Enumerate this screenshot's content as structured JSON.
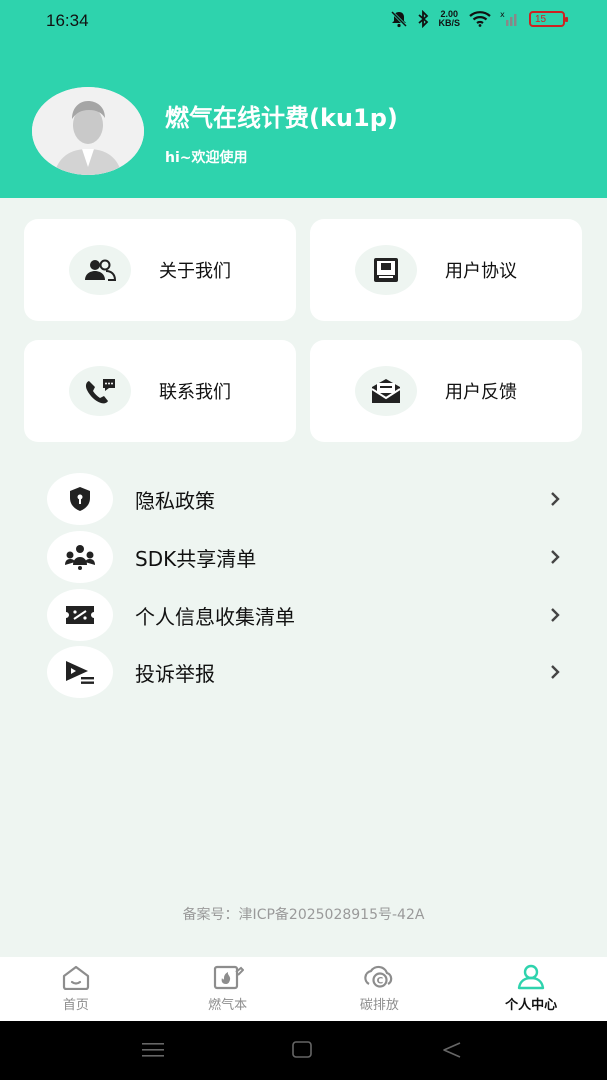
{
  "status_bar": {
    "time": "16:34",
    "net_speed_value": "2.00",
    "net_speed_unit": "KB/S",
    "battery": "15"
  },
  "profile": {
    "title": "燃气在线计费(ku1p)",
    "subtitle": "hi~欢迎使用"
  },
  "cards": [
    {
      "label": "关于我们",
      "icon": "people-icon"
    },
    {
      "label": "用户协议",
      "icon": "document-icon"
    },
    {
      "label": "联系我们",
      "icon": "phone-chat-icon"
    },
    {
      "label": "用户反馈",
      "icon": "mail-icon"
    }
  ],
  "list": [
    {
      "label": "隐私政策",
      "icon": "shield-lock-icon"
    },
    {
      "label": "SDK共享清单",
      "icon": "group-icon"
    },
    {
      "label": "个人信息收集清单",
      "icon": "ticket-icon"
    },
    {
      "label": "投诉举报",
      "icon": "report-play-icon"
    }
  ],
  "icp": "备案号：津ICP备2025028915号-42A",
  "tabs": [
    {
      "label": "首页",
      "icon": "home-icon"
    },
    {
      "label": "燃气本",
      "icon": "book-fire-icon"
    },
    {
      "label": "碳排放",
      "icon": "carbon-icon"
    },
    {
      "label": "个人中心",
      "icon": "user-icon",
      "active": true
    }
  ],
  "colors": {
    "accent": "#2ed3ad",
    "background": "#eef5f1"
  }
}
